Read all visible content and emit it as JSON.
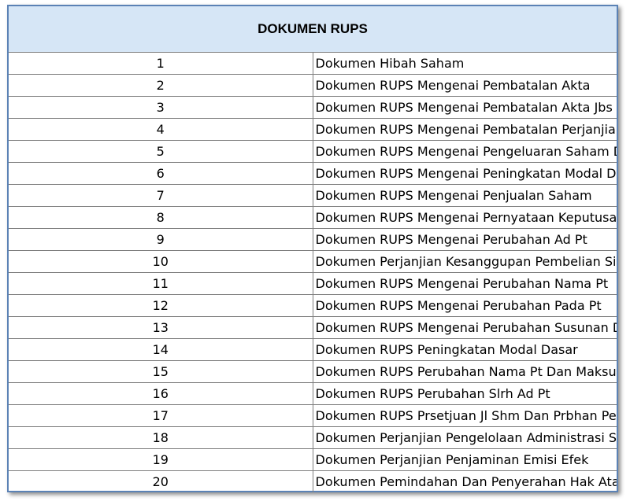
{
  "title": "DOKUMEN RUPS",
  "colors": {
    "header_bg": "#d6e6f6",
    "border": "#5b82b5",
    "grid": "#7f7f7f"
  },
  "rows": [
    {
      "no": "1",
      "label": "Dokumen Hibah Saham"
    },
    {
      "no": "2",
      "label": "Dokumen RUPS Mengenai Pembatalan Akta"
    },
    {
      "no": "3",
      "label": "Dokumen RUPS Mengenai Pembatalan Akta Jbs"
    },
    {
      "no": "4",
      "label": "Dokumen RUPS Mengenai Pembatalan Perjanjian"
    },
    {
      "no": "5",
      "label": "Dokumen RUPS Mengenai Pengeluaran Saham Dlm Simpanan"
    },
    {
      "no": "6",
      "label": "Dokumen RUPS Mengenai Peningkatan Modal Dasar"
    },
    {
      "no": "7",
      "label": "Dokumen RUPS Mengenai Penjualan Saham"
    },
    {
      "no": "8",
      "label": "Dokumen RUPS Mengenai Pernyataan Keputusan Rapat"
    },
    {
      "no": "9",
      "label": "Dokumen RUPS Mengenai Perubahan Ad Pt"
    },
    {
      "no": "10",
      "label": "Dokumen Perjanjian Kesanggupan Pembelian Sisa Saham"
    },
    {
      "no": "11",
      "label": "Dokumen RUPS Mengenai Perubahan Nama Pt"
    },
    {
      "no": "12",
      "label": "Dokumen RUPS Mengenai Perubahan Pada Pt"
    },
    {
      "no": "13",
      "label": "Dokumen RUPS Mengenai Perubahan Susunan Direksi"
    },
    {
      "no": "14",
      "label": "Dokumen RUPS Peningkatan Modal Dasar"
    },
    {
      "no": "15",
      "label": "Dokumen RUPS Perubahan Nama Pt Dan Maksud Tujuan"
    },
    {
      "no": "16",
      "label": "Dokumen RUPS Perubahan Slrh Ad Pt"
    },
    {
      "no": "17",
      "label": "Dokumen RUPS Prsetjuan Jl Shm Dan Prbhan Pengurus Bar"
    },
    {
      "no": "18",
      "label": "Dokumen Perjanjian Pengelolaan Administrasi Saham"
    },
    {
      "no": "19",
      "label": "Dokumen Perjanjian Penjaminan Emisi Efek"
    },
    {
      "no": "20",
      "label": "Dokumen Pemindahan Dan Penyerahan Hak Atas Saham"
    }
  ]
}
